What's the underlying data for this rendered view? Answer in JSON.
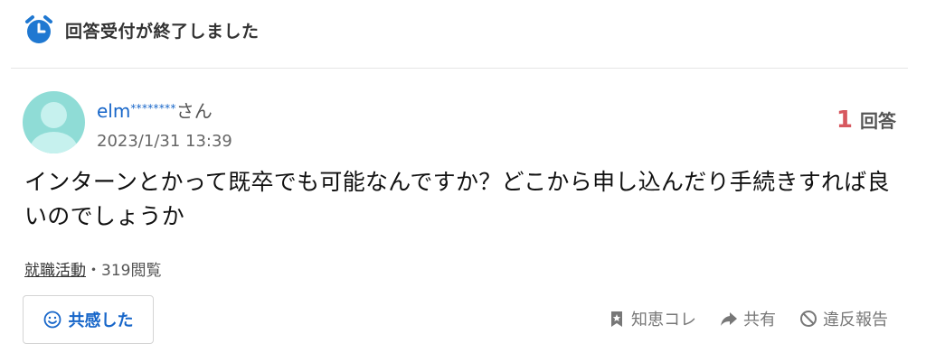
{
  "status": {
    "icon": "alarm-clock-icon",
    "text": "回答受付が終了しました"
  },
  "user": {
    "name": "elm",
    "mask": "********",
    "suffix": "さん",
    "date": "2023/1/31 13:39"
  },
  "answers": {
    "count": "1",
    "label": "回答"
  },
  "question": {
    "text": "インターンとかって既卒でも可能なんですか？どこから申し込んだり手続きすれば良いのでしょうか"
  },
  "meta": {
    "category": "就職活動",
    "separator": "・",
    "views": "319閲覧"
  },
  "actions": {
    "empathy": "共感した",
    "chiekore": "知恵コレ",
    "share": "共有",
    "report": "違反報告"
  },
  "colors": {
    "accent": "#1766c9",
    "answer_count": "#d7585f",
    "avatar": "#8fdcd6"
  }
}
